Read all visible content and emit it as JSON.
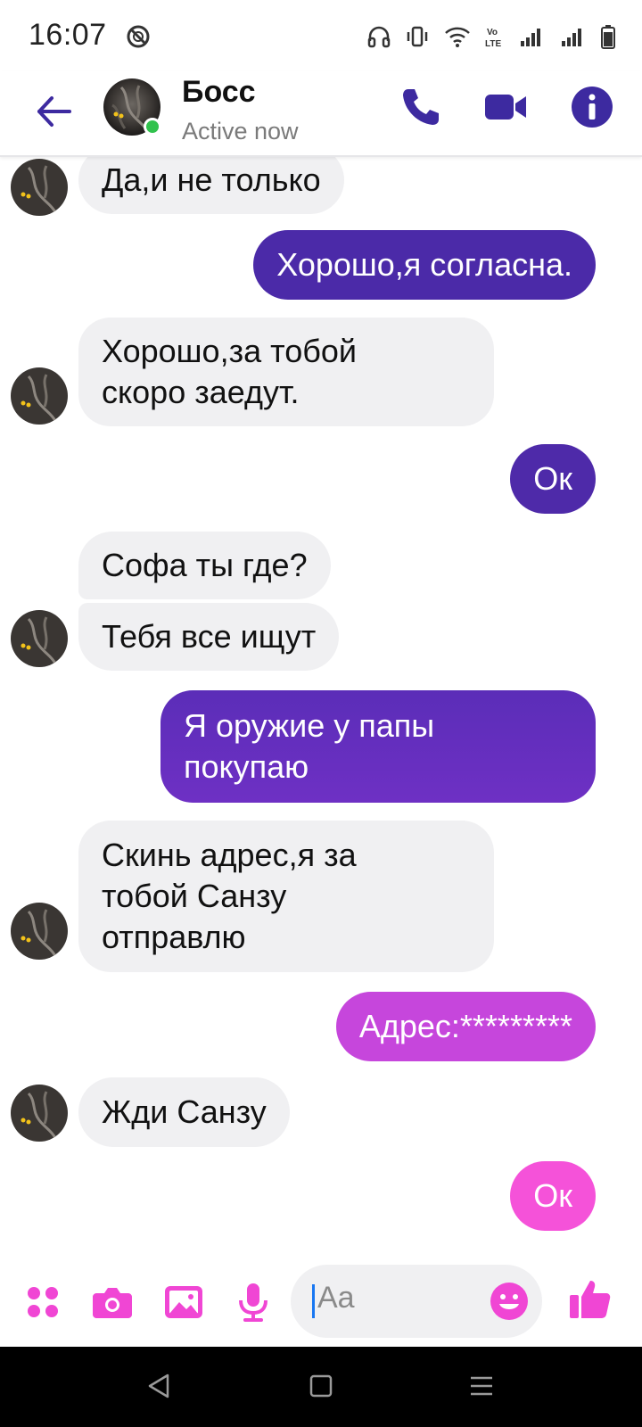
{
  "status_bar": {
    "time": "16:07",
    "icons": [
      "dnd-icon",
      "headphones-icon",
      "vibrate-icon",
      "wifi-icon",
      "volte-icon",
      "signal-icon",
      "signal-icon",
      "battery-icon"
    ]
  },
  "header": {
    "back_icon": "arrow-left-icon",
    "name": "Босс",
    "status": "Active now",
    "actions": [
      "phone-icon",
      "video-camera-icon",
      "info-icon"
    ]
  },
  "messages": [
    {
      "direction": "incoming",
      "lines": [
        "Да,и не только"
      ]
    },
    {
      "direction": "outgoing",
      "lines": [
        "Хорошо,я согласна."
      ],
      "color": "#4b2aa8"
    },
    {
      "direction": "incoming",
      "lines": [
        "Хорошо,за тобой",
        "скоро заедут."
      ]
    },
    {
      "direction": "outgoing",
      "lines": [
        "Ок"
      ],
      "color": "#4e2aa9"
    },
    {
      "direction": "incoming",
      "lines": [
        "Софа ты где?"
      ]
    },
    {
      "direction": "incoming",
      "lines": [
        "Тебя все ищут"
      ]
    },
    {
      "direction": "outgoing",
      "lines": [
        "Я оружие у папы",
        "покупаю"
      ],
      "color": "#6a2fc0"
    },
    {
      "direction": "incoming",
      "lines": [
        "Скинь адрес,я за",
        "тобой Санзу",
        "отправлю"
      ]
    },
    {
      "direction": "outgoing",
      "lines": [
        "Адрес:*********"
      ],
      "color": "#c646dc"
    },
    {
      "direction": "incoming",
      "lines": [
        "Жди Санзу"
      ]
    },
    {
      "direction": "outgoing",
      "lines": [
        "Ок"
      ],
      "color": "#f552d9"
    }
  ],
  "composer": {
    "placeholder": "Aa",
    "icons": [
      "apps-grid-icon",
      "camera-icon",
      "image-icon",
      "microphone-icon",
      "emoji-icon",
      "thumbs-up-icon"
    ],
    "accent": "#f046d4"
  },
  "nav_bar": {
    "icons": [
      "back-triangle-icon",
      "home-square-icon",
      "menu-lines-icon"
    ]
  },
  "colors": {
    "brand": "#3d2aa0",
    "incoming_bubble": "#f0f0f2",
    "online": "#31c24d"
  }
}
